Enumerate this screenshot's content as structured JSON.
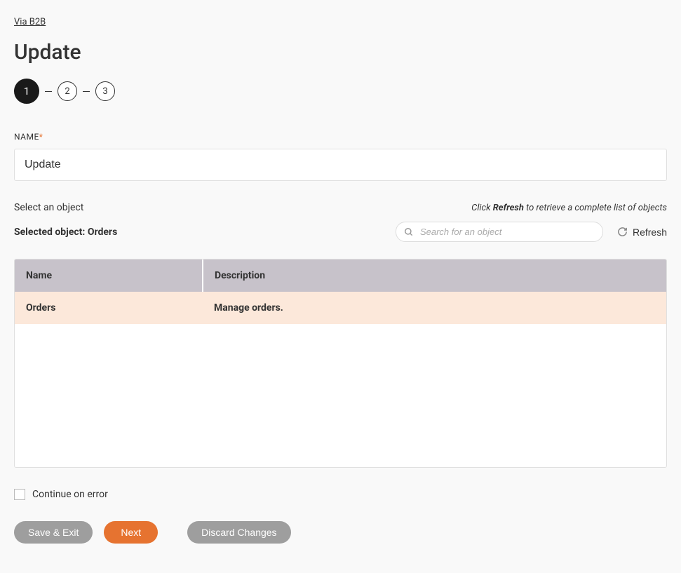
{
  "breadcrumb": "Via B2B",
  "pageTitle": "Update",
  "stepper": {
    "steps": [
      "1",
      "2",
      "3"
    ],
    "activeIndex": 0
  },
  "nameField": {
    "label": "NAME",
    "required": true,
    "value": "Update"
  },
  "objectSection": {
    "selectHint": "Select an object",
    "refreshHintPrefix": "Click ",
    "refreshHintBold": "Refresh",
    "refreshHintSuffix": " to retrieve a complete list of objects",
    "selectedPrefix": "Selected object: ",
    "selectedValue": "Orders",
    "searchPlaceholder": "Search for an object",
    "refreshLabel": "Refresh"
  },
  "table": {
    "headers": [
      "Name",
      "Description"
    ],
    "rows": [
      {
        "name": "Orders",
        "description": "Manage orders.",
        "selected": true
      }
    ]
  },
  "continueOnError": {
    "label": "Continue on error",
    "checked": false
  },
  "buttons": {
    "saveExit": "Save & Exit",
    "next": "Next",
    "discard": "Discard Changes"
  }
}
